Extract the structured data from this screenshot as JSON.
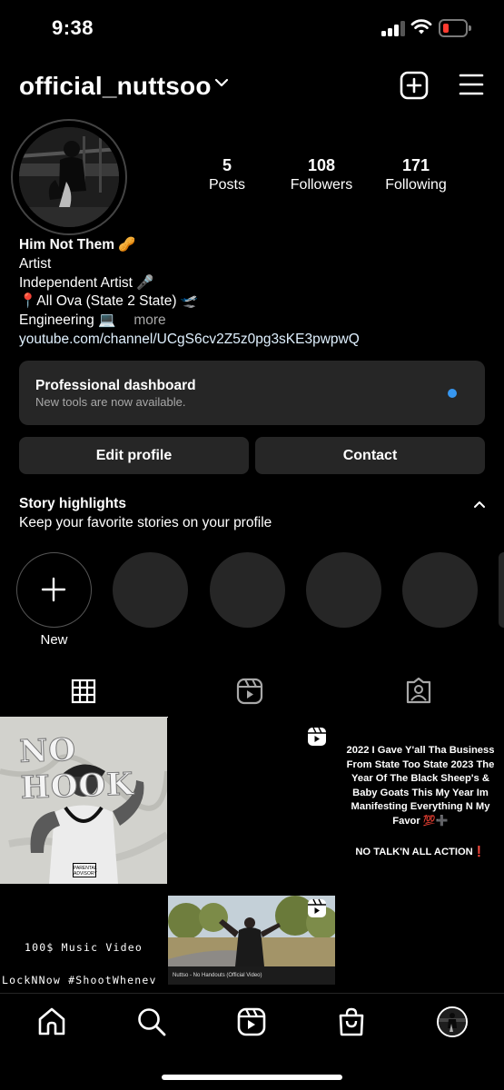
{
  "status_bar": {
    "time": "9:38",
    "battery_color": "#ff3b30"
  },
  "header": {
    "username": "official_nuttsoo",
    "icons": [
      "chevron-down-icon",
      "create-plus-icon",
      "menu-hamburger-icon"
    ]
  },
  "profile": {
    "stats": [
      {
        "value": "5",
        "label": "Posts"
      },
      {
        "value": "108",
        "label": "Followers"
      },
      {
        "value": "171",
        "label": "Following"
      }
    ],
    "bio": {
      "name": "Him Not Them 🥜",
      "category": "Artist",
      "line1": "Independent Artist 🎤",
      "line2": "📍All Ova (State 2 State) 🛫",
      "line3": "Engineering 💻",
      "more": "more",
      "link": "youtube.com/channel/UCgS6cv2Z5z0pg3sKE3pwpwQ"
    }
  },
  "dashboard": {
    "title": "Professional dashboard",
    "subtitle": "New tools are now available.",
    "dot_color": "#3797f0"
  },
  "buttons": {
    "edit_profile": "Edit profile",
    "contact": "Contact"
  },
  "highlights": {
    "title": "Story highlights",
    "subtitle": "Keep your favorite stories on your profile",
    "new_label": "New"
  },
  "tabs": [
    "grid-icon",
    "reels-icon",
    "tagged-icon"
  ],
  "posts": {
    "post1_title": "NO HOOK",
    "post1_badge": "PARENTAL ADVISORY",
    "post3_text": "2022 I Gave Y'all Tha Business From State Too State 2023 The Year Of The Black Sheep's & Baby Goats This My Year Im Manifesting Everything N My Favor 💯➕",
    "post3_text2": "NO TALK'N ALL ACTION❗",
    "post4_line1": "100$ Music Video",
    "post4_line2": "LockNNow #ShootWhenev",
    "post5_caption": "Nuttso - No Handouts (Official Video)"
  },
  "bottom_nav": [
    "home-icon",
    "search-icon",
    "reels-icon",
    "shop-icon",
    "profile-avatar"
  ]
}
